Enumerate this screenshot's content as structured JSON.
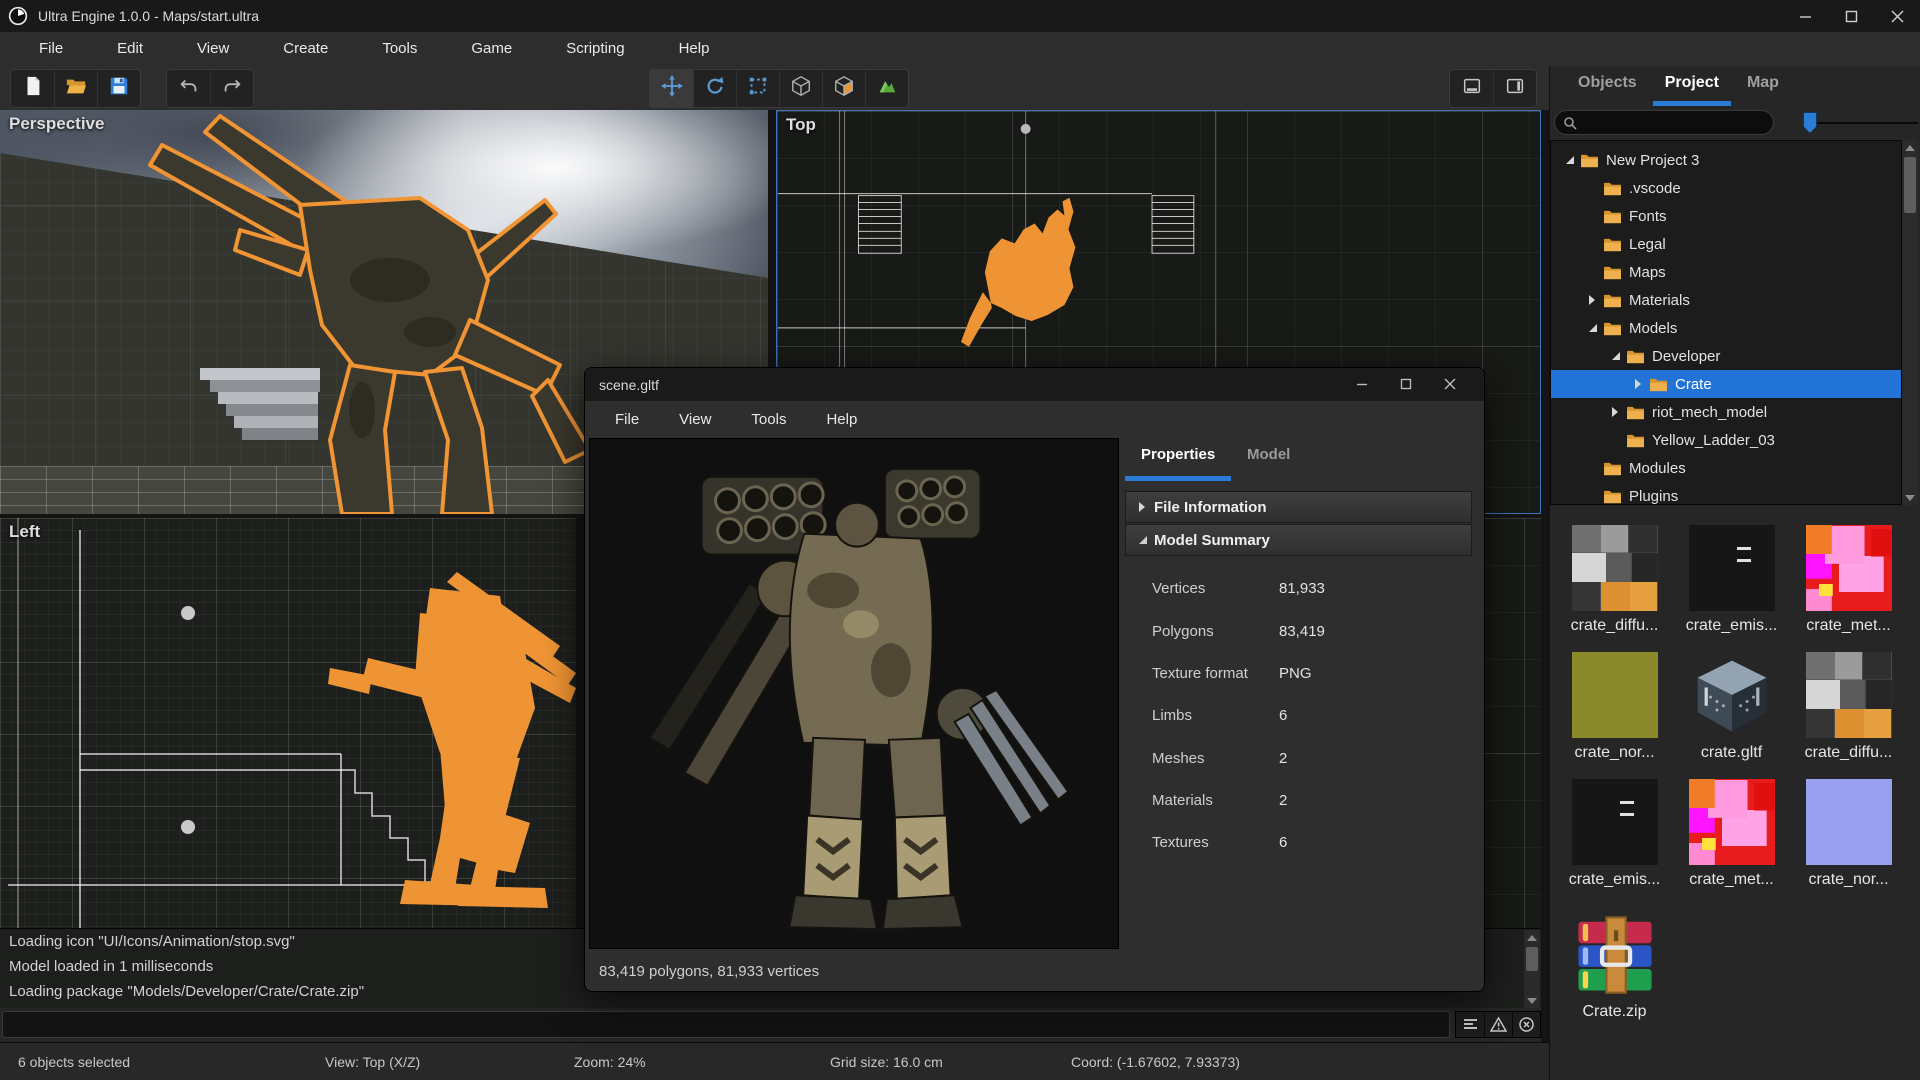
{
  "window": {
    "title": "Ultra Engine 1.0.0 - Maps/start.ultra",
    "controls": [
      "minimize",
      "maximize",
      "close"
    ]
  },
  "menu_bar": [
    "File",
    "Edit",
    "View",
    "Create",
    "Tools",
    "Game",
    "Scripting",
    "Help"
  ],
  "toolbar": {
    "file_group": [
      "new-file",
      "open-folder",
      "save"
    ],
    "history_group": [
      "undo",
      "redo"
    ],
    "transform_group": [
      "translate",
      "rotate",
      "rect-select",
      "wireframe-cube",
      "textured-cube",
      "terrain"
    ],
    "transform_active": "translate",
    "panel_group": [
      "toggle-bottom-panel",
      "toggle-right-panel"
    ]
  },
  "viewports": {
    "perspective": "Perspective",
    "top": "Top",
    "left": "Left"
  },
  "dialog": {
    "title": "scene.gltf",
    "controls": [
      "minimize",
      "maximize",
      "close"
    ],
    "menu": [
      "File",
      "View",
      "Tools",
      "Help"
    ],
    "tabs": [
      {
        "label": "Properties",
        "active": true
      },
      {
        "label": "Model",
        "active": false
      }
    ],
    "sections": [
      {
        "label": "File Information",
        "expanded": false
      },
      {
        "label": "Model Summary",
        "expanded": true
      }
    ],
    "properties": [
      {
        "label": "Vertices",
        "value": "81,933"
      },
      {
        "label": "Polygons",
        "value": "83,419"
      },
      {
        "label": "Texture format",
        "value": "PNG"
      },
      {
        "label": "Limbs",
        "value": "6"
      },
      {
        "label": "Meshes",
        "value": "2"
      },
      {
        "label": "Materials",
        "value": "2"
      },
      {
        "label": "Textures",
        "value": "6"
      }
    ],
    "status": "83,419 polygons, 81,933 vertices"
  },
  "right_panel": {
    "tabs": [
      {
        "label": "Objects",
        "active": false
      },
      {
        "label": "Project",
        "active": true
      },
      {
        "label": "Map",
        "active": false
      }
    ],
    "search": {
      "value": "",
      "placeholder": ""
    },
    "tree": [
      {
        "label": "New Project 3",
        "depth": 0,
        "arrow": "expanded",
        "selected": false
      },
      {
        "label": ".vscode",
        "depth": 1,
        "arrow": "none",
        "selected": false
      },
      {
        "label": "Fonts",
        "depth": 1,
        "arrow": "none",
        "selected": false
      },
      {
        "label": "Legal",
        "depth": 1,
        "arrow": "none",
        "selected": false
      },
      {
        "label": "Maps",
        "depth": 1,
        "arrow": "none",
        "selected": false
      },
      {
        "label": "Materials",
        "depth": 1,
        "arrow": "collapsed",
        "selected": false
      },
      {
        "label": "Models",
        "depth": 1,
        "arrow": "expanded",
        "selected": false
      },
      {
        "label": "Developer",
        "depth": 2,
        "arrow": "expanded",
        "selected": false
      },
      {
        "label": "Crate",
        "depth": 3,
        "arrow": "collapsed",
        "selected": true
      },
      {
        "label": "riot_mech_model",
        "depth": 2,
        "arrow": "collapsed",
        "selected": false
      },
      {
        "label": "Yellow_Ladder_03",
        "depth": 2,
        "arrow": "none",
        "selected": false
      },
      {
        "label": "Modules",
        "depth": 1,
        "arrow": "none",
        "selected": false
      },
      {
        "label": "Plugins",
        "depth": 1,
        "arrow": "none",
        "selected": false
      }
    ],
    "assets": [
      {
        "name": "crate_diffu...",
        "kind": "diffuse"
      },
      {
        "name": "crate_emis...",
        "kind": "emissive"
      },
      {
        "name": "crate_met...",
        "kind": "metal"
      },
      {
        "name": "crate_nor...",
        "kind": "normal-olive"
      },
      {
        "name": "crate.gltf",
        "kind": "gltf"
      },
      {
        "name": "crate_diffu...",
        "kind": "diffuse"
      },
      {
        "name": "crate_emis...",
        "kind": "emissive"
      },
      {
        "name": "crate_met...",
        "kind": "metal"
      },
      {
        "name": "crate_nor...",
        "kind": "normal-blue"
      },
      {
        "name": "Crate.zip",
        "kind": "zip"
      }
    ]
  },
  "console": {
    "lines": [
      "Loading icon \"UI/Icons/Animation/stop.svg\"",
      "Model loaded in 1 milliseconds",
      "Loading package \"Models/Developer/Crate/Crate.zip\""
    ]
  },
  "command_bar": {
    "value": "",
    "buttons": [
      "log-list",
      "warnings",
      "clear"
    ]
  },
  "status_bar": {
    "items": [
      "6 objects selected",
      "View: Top (X/Z)",
      "Zoom: 24%",
      "Grid size: 16.0 cm",
      "Coord: (-1.67602, 7.93373)"
    ]
  },
  "colors": {
    "accent_blue": "#2b7cd6",
    "selection_blue": "#2273d6",
    "selection_outline_orange": "#ef9434",
    "folder_yellow": "#e8a33c"
  }
}
